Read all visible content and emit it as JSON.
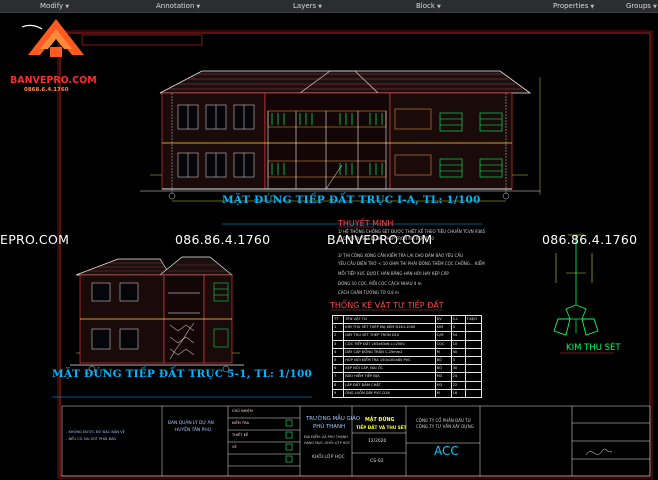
{
  "ribbon": {
    "tabs": [
      "Modify",
      "Annotation",
      "Layers",
      "Block",
      "Properties",
      "Groups"
    ]
  },
  "logo": {
    "brand": "BANVEPRO.COM",
    "phone": "0868.6.4.1760",
    "colors": {
      "orange": "#ff5a1f",
      "brand_red": "#ff2a2a"
    }
  },
  "drawing": {
    "title_top": "MẶT ĐỨNG TIẾP ĐẤT TRỤC I-A, TL: 1/100",
    "title_bottom": "MẶT ĐỨNG TIẾP ĐẤT TRỤC 5-1, TL: 1/100",
    "watermarks": [
      "EPRO.COM",
      "086.86.4.1760",
      "BANVEPRO.COM",
      "086.86.4.1760"
    ],
    "notes_title": "THUYẾT MINH",
    "notes": [
      "1/ HỆ THỐNG CHỐNG SÉT ĐƯỢC THIẾT KẾ THEO TIÊU CHUẨN TCVN 9385",
      "2/ DÂY THU SÉT DÙNG THÉP TRÒN MẠ KẼM D10",
      "3/ THI CÔNG XONG CẦN KIỂM TRA LẠI CHO ĐẢM BẢO YÊU CẦU",
      "YÊU CẦU ĐIỆN TRỞ < 10 OHM THI PHẢI ĐÓNG THÊM CỌC CHỐNG... KIỂM",
      "MỖI TIẾP XÚC ĐƯỢC HÀN BẰNG HÀN HƠI HAY KẸP CÁP",
      "ĐÓNG 10 CỌC, MỖI CỌC CÁCH NHAU 4 m",
      "CÁCH CHÂN TƯỜNG TỪ 0.8 m"
    ],
    "table_title": "THỐNG KÊ VẬT TƯ TIẾP ĐẤT",
    "table_header": [
      "TT",
      "TÊN VẬT TƯ",
      "ĐV",
      "S.L",
      "T.KẸO"
    ],
    "table_rows": [
      [
        "1",
        "KIM THU SÉT THÉP MẠ KẼM D16-L1000",
        "KIM",
        "3",
        ""
      ],
      [
        "2",
        "DÂY THU SÉT THÉP TRÒN D10",
        "C/M",
        "54",
        ""
      ],
      [
        "3",
        "CỌC TIẾP ĐẤT L63x63x6 L=2500",
        "CỌC",
        "10",
        ""
      ],
      [
        "4",
        "DÂY CÁP ĐỒNG TRẦN C.25mm2",
        "M",
        "40",
        ""
      ],
      [
        "5",
        "HỘP NỐI KIỂM TRA 150x100x80 PVC",
        "BỘ",
        "3",
        ""
      ],
      [
        "6",
        "KẸP NỐI CÁP, ĐAI ỐC",
        "BỘ",
        "30",
        ""
      ],
      [
        "7",
        "BẢO HIỂM TIẾP ĐỊA",
        "M3",
        "24",
        ""
      ],
      [
        "8",
        "LẤP ĐẤT ĐẦM CHẶT",
        "M3",
        "22",
        ""
      ],
      [
        "9",
        "ỐNG LUỒN DÂY PVC D16",
        "M",
        "16",
        ""
      ]
    ],
    "kim_label": "KIM THU SÉT",
    "colors": {
      "title": "#00b7ff",
      "lines": "#ff3030",
      "green": "#00ff66",
      "yellow": "#ffff3a"
    }
  },
  "title_block": {
    "owner_lines": [
      "BAN QUẢN LÝ DỰ ÁN",
      "HUYỆN TÂN PHÚ"
    ],
    "project_lines": [
      "TRƯỜNG MẪU GIÁO",
      "PHÚ THẠNH"
    ],
    "sub_lines": [
      "ĐỊA ĐIỂM: XÃ PHÚ THẠNH",
      "HẠNG MỤC: KHỐI LỚP HỌC"
    ],
    "block": "KHỐI LỚP HỌC",
    "sheet_title_lines": [
      "MẶT ĐỨNG",
      "TIẾP ĐẤT VÀ THU SÉT"
    ],
    "date": "12/2020",
    "sheet_no": "CS-02",
    "consultant": "ACC",
    "company_lines": [
      "CÔNG TY CỔ PHẦN ĐẦU TƯ",
      "CÔNG TY TƯ VẤN XÂY DỰNG"
    ],
    "left_notes": [
      "- KHÔNG ĐƯỢC ĐO ĐẠC BẢN VẼ",
      "- NẾU CÓ SAI SÓT PHẢI BÁO"
    ],
    "sign_roles": [
      "CHỦ NHIỆM",
      "KIỂM TRA",
      "THIẾT KẾ",
      "VẼ"
    ]
  }
}
